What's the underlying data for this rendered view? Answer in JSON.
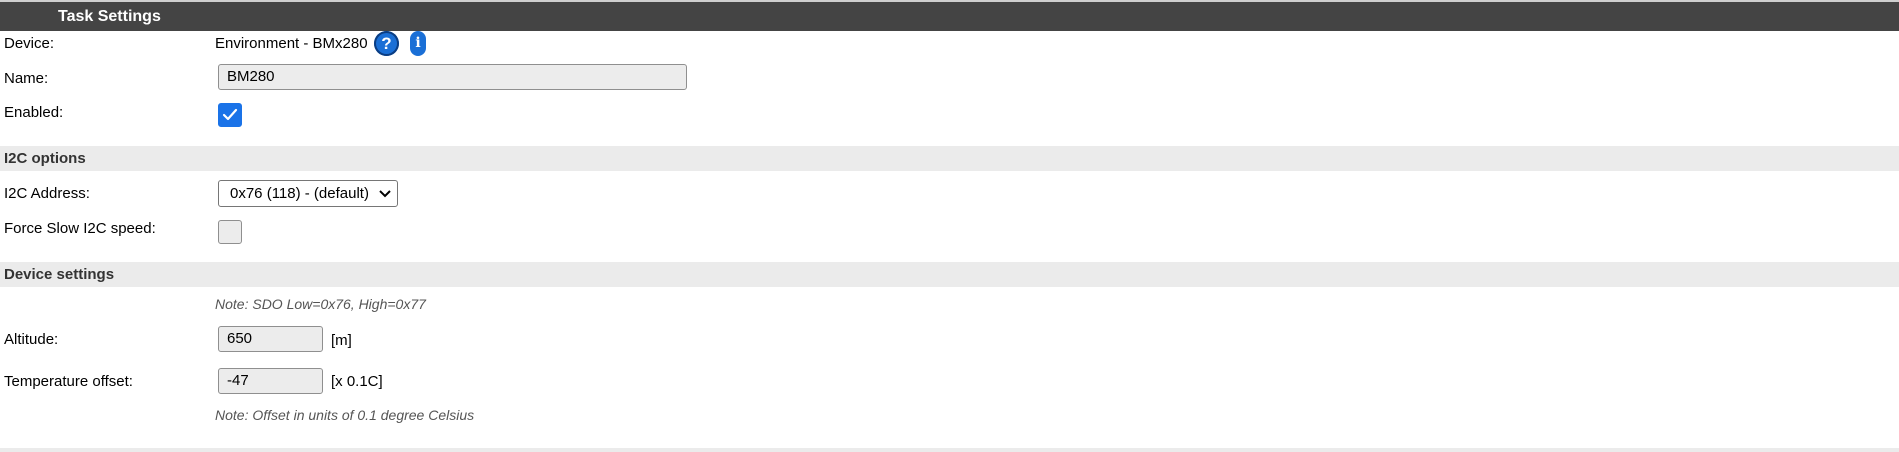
{
  "header": {
    "title": "Task Settings"
  },
  "device": {
    "label": "Device:",
    "value": "Environment - BMx280",
    "help_icon_glyph": "?",
    "info_icon_glyph": "i",
    "help_icon": "question-circle-icon",
    "info_icon": "info-icon"
  },
  "name": {
    "label": "Name:",
    "value": "BM280"
  },
  "enabled": {
    "label": "Enabled:",
    "checked": true
  },
  "i2c_section": {
    "title": "I2C options"
  },
  "i2c_address": {
    "label": "I2C Address:",
    "selected": "0x76 (118) - (default)"
  },
  "force_slow": {
    "label": "Force Slow I2C speed:",
    "checked": false
  },
  "device_section": {
    "title": "Device settings"
  },
  "note_sdo": "Note: SDO Low=0x76, High=0x77",
  "altitude": {
    "label": "Altitude:",
    "value": "650",
    "unit": "[m]"
  },
  "temp_offset": {
    "label": "Temperature offset:",
    "value": "-47",
    "unit": "[x 0.1C]"
  },
  "note_offset": "Note: Offset in units of 0.1 degree Celsius",
  "colors": {
    "header_bg": "#444444",
    "section_bg": "#ebebeb",
    "accent": "#1a73e8"
  }
}
